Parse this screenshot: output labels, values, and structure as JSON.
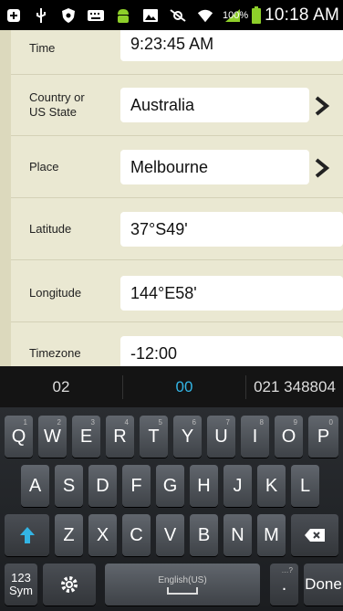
{
  "status_bar": {
    "battery_percent": "100%",
    "time": "10:18 AM"
  },
  "form": {
    "rows": [
      {
        "label": "Time",
        "value": "9:23:45 AM"
      },
      {
        "label": "Country or US State",
        "value": "Australia"
      },
      {
        "label": "Place",
        "value": "Melbourne"
      },
      {
        "label": "Latitude",
        "value": "37°S49'"
      },
      {
        "label": "Longitude",
        "value": "144°E58'"
      },
      {
        "label": "Timezone",
        "value": "-12:00"
      }
    ]
  },
  "suggestions": [
    "02",
    "00",
    "021 348804"
  ],
  "accent_color": "#33b5e5",
  "keyboard": {
    "row1": [
      {
        "k": "Q",
        "h": "1"
      },
      {
        "k": "W",
        "h": "2"
      },
      {
        "k": "E",
        "h": "3"
      },
      {
        "k": "R",
        "h": "4"
      },
      {
        "k": "T",
        "h": "5"
      },
      {
        "k": "Y",
        "h": "6"
      },
      {
        "k": "U",
        "h": "7"
      },
      {
        "k": "I",
        "h": "8"
      },
      {
        "k": "O",
        "h": "9"
      },
      {
        "k": "P",
        "h": "0"
      }
    ],
    "row2": [
      "A",
      "S",
      "D",
      "F",
      "G",
      "H",
      "J",
      "K",
      "L"
    ],
    "row3": [
      "Z",
      "X",
      "C",
      "V",
      "B",
      "N",
      "M"
    ],
    "sym_label_1": "123",
    "sym_label_2": "Sym",
    "space_label": "English(US)",
    "period_key": ".",
    "period_hint": "…?",
    "done_label": "Done"
  }
}
